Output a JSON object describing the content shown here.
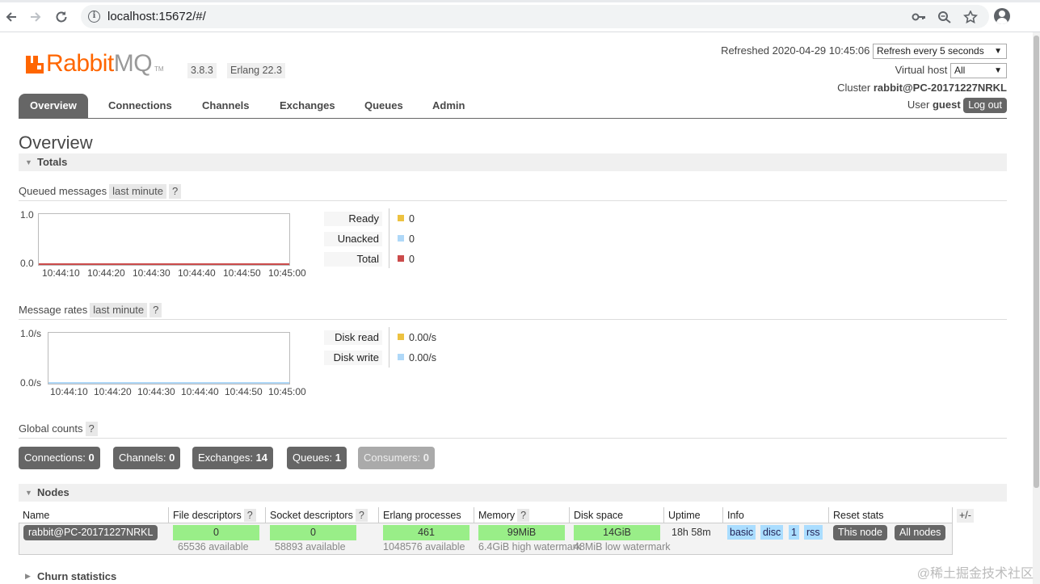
{
  "browser": {
    "url": "localhost:15672/#/"
  },
  "header": {
    "logo_rabbit": "Rabbit",
    "logo_mq": "MQ",
    "logo_tm": "TM",
    "version": "3.8.3",
    "erlang": "Erlang 22.3",
    "refreshed_label": "Refreshed 2020-04-29 10:45:06",
    "refresh_select": "Refresh every 5 seconds",
    "virtual_host_label": "Virtual host",
    "virtual_host_select": "All",
    "cluster_label": "Cluster",
    "cluster_name": "rabbit@PC-20171227NRKL",
    "user_label": "User",
    "user_name": "guest",
    "logout_label": "Log out"
  },
  "tabs": [
    {
      "label": "Overview",
      "active": true
    },
    {
      "label": "Connections"
    },
    {
      "label": "Channels"
    },
    {
      "label": "Exchanges"
    },
    {
      "label": "Queues"
    },
    {
      "label": "Admin"
    }
  ],
  "page_title": "Overview",
  "totals": {
    "section_label": "Totals",
    "queued": {
      "label": "Queued messages",
      "range_tag": "last minute",
      "help": "?",
      "y_top": "1.0",
      "y_bottom": "0.0",
      "x_ticks": [
        "10:44:10",
        "10:44:20",
        "10:44:30",
        "10:44:40",
        "10:44:50",
        "10:45:00"
      ],
      "legend": [
        {
          "label": "Ready",
          "value": "0",
          "color": "#edc240"
        },
        {
          "label": "Unacked",
          "value": "0",
          "color": "#afd8f8"
        },
        {
          "label": "Total",
          "value": "0",
          "color": "#cb4b4b"
        }
      ]
    },
    "rates": {
      "label": "Message rates",
      "range_tag": "last minute",
      "help": "?",
      "y_top": "1.0/s",
      "y_bottom": "0.0/s",
      "x_ticks": [
        "10:44:10",
        "10:44:20",
        "10:44:30",
        "10:44:40",
        "10:44:50",
        "10:45:00"
      ],
      "legend": [
        {
          "label": "Disk read",
          "value": "0.00/s",
          "color": "#edc240"
        },
        {
          "label": "Disk write",
          "value": "0.00/s",
          "color": "#afd8f8"
        }
      ]
    },
    "global_counts": {
      "label": "Global counts",
      "help": "?",
      "items": [
        {
          "label": "Connections:",
          "value": "0"
        },
        {
          "label": "Channels:",
          "value": "0"
        },
        {
          "label": "Exchanges:",
          "value": "14"
        },
        {
          "label": "Queues:",
          "value": "1"
        },
        {
          "label": "Consumers:",
          "value": "0"
        }
      ]
    }
  },
  "nodes": {
    "section_label": "Nodes",
    "columns": {
      "name": "Name",
      "file_desc": "File descriptors",
      "socket_desc": "Socket descriptors",
      "erlang_proc": "Erlang processes",
      "memory": "Memory",
      "disk": "Disk space",
      "uptime": "Uptime",
      "info": "Info",
      "reset": "Reset stats",
      "help": "?"
    },
    "plus_minus": "+/-",
    "row": {
      "name": "rabbit@PC-20171227NRKL",
      "file_desc": "0",
      "file_desc_avail": "65536 available",
      "socket_desc": "0",
      "socket_desc_avail": "58893 available",
      "erlang_proc": "461",
      "erlang_proc_avail": "1048576 available",
      "memory": "99MiB",
      "memory_watermark": "6.4GiB high watermark",
      "disk": "14GiB",
      "disk_watermark": "48MiB low watermark",
      "uptime": "18h 58m",
      "info_tags": [
        "basic",
        "disc",
        "1",
        "rss"
      ],
      "reset_this": "This node",
      "reset_all": "All nodes"
    }
  },
  "churn_label": "Churn statistics",
  "watermark": "@稀土掘金技术社区",
  "colors": {
    "brand": "#ff6600",
    "tab_active": "#666666",
    "bar_green": "#99ee88",
    "info_blue": "#aaddff"
  }
}
